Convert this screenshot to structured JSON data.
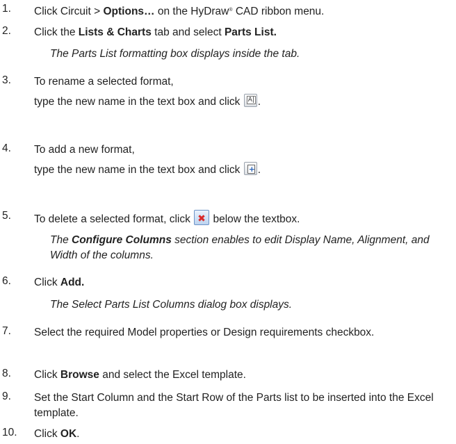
{
  "steps": [
    {
      "num": "1.",
      "pre": "Click Circuit > ",
      "bold": "Options…",
      "post": " on the HyDraw",
      "reg": "®",
      "post2": " CAD ribbon menu."
    },
    {
      "num": "2.",
      "pre": "Click the ",
      "bold": "Lists & Charts",
      "mid": " tab and select ",
      "bold2": "Parts List.",
      "note": "The Parts List formatting box displays inside the tab."
    },
    {
      "num": "3.",
      "line1": "To rename a selected format,",
      "line2": "type the new name in the text box and click",
      "end": "."
    },
    {
      "num": "4.",
      "line1": "To add a new format,",
      "line2": "type the new name in the text box and click",
      "end": "."
    },
    {
      "num": "5.",
      "pre": "To delete a selected format, click",
      "post": " below the textbox.",
      "note_pre": "The ",
      "note_bold": "Configure Columns",
      "note_post": " section enables to edit Display Name, Alignment, and Width of the columns."
    },
    {
      "num": "6.",
      "pre": "Click ",
      "bold": "Add.",
      "note": "The Select Parts List Columns dialog box displays."
    },
    {
      "num": "7.",
      "text": "Select the required Model properties or Design requirements checkbox."
    },
    {
      "num": "8.",
      "pre": "Click ",
      "bold": "Browse",
      "post": " and select the Excel template."
    },
    {
      "num": "9.",
      "text": "Set the Start Column and the Start Row of the Parts list to be inserted into the Excel template."
    },
    {
      "num": "10.",
      "pre": "Click ",
      "bold": "OK",
      "post": "."
    }
  ],
  "icons": {
    "rename": "rename-format-icon",
    "add": "add-format-icon",
    "delete": "delete-format-icon"
  },
  "colors": {
    "text": "#222222",
    "delete_x": "#d92a2a"
  }
}
